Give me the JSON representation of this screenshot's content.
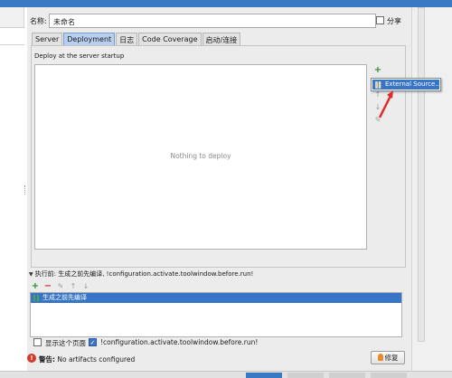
{
  "form": {
    "name_label": "名称:",
    "name_value": "未命名",
    "share_label": "分享"
  },
  "tabs": [
    {
      "label": "Server"
    },
    {
      "label": "Deployment"
    },
    {
      "label": "日志"
    },
    {
      "label": "Code Coverage"
    },
    {
      "label": "启动/连接"
    }
  ],
  "deployment": {
    "section_title": "Deploy at the server startup",
    "empty_text": "Nothing to deploy",
    "popup_item": "External Source..."
  },
  "before_run": {
    "header": "执行前: 生成之前先编译, !configuration.activate.toolwindow.before.run!",
    "items": [
      "生成之前先编译"
    ]
  },
  "options": {
    "show_page_label": "显示这个页面",
    "activate_label": "!configuration.activate.toolwindow.before.run!"
  },
  "warning": {
    "prefix": "警告:",
    "text": "No artifacts configured"
  },
  "fix_button_label": "修复",
  "colors": {
    "accent": "#3875c6",
    "add": "#2e8b2e",
    "remove": "#cc2a2a",
    "warning": "#d23a2a",
    "arrow": "#e02a2a"
  }
}
